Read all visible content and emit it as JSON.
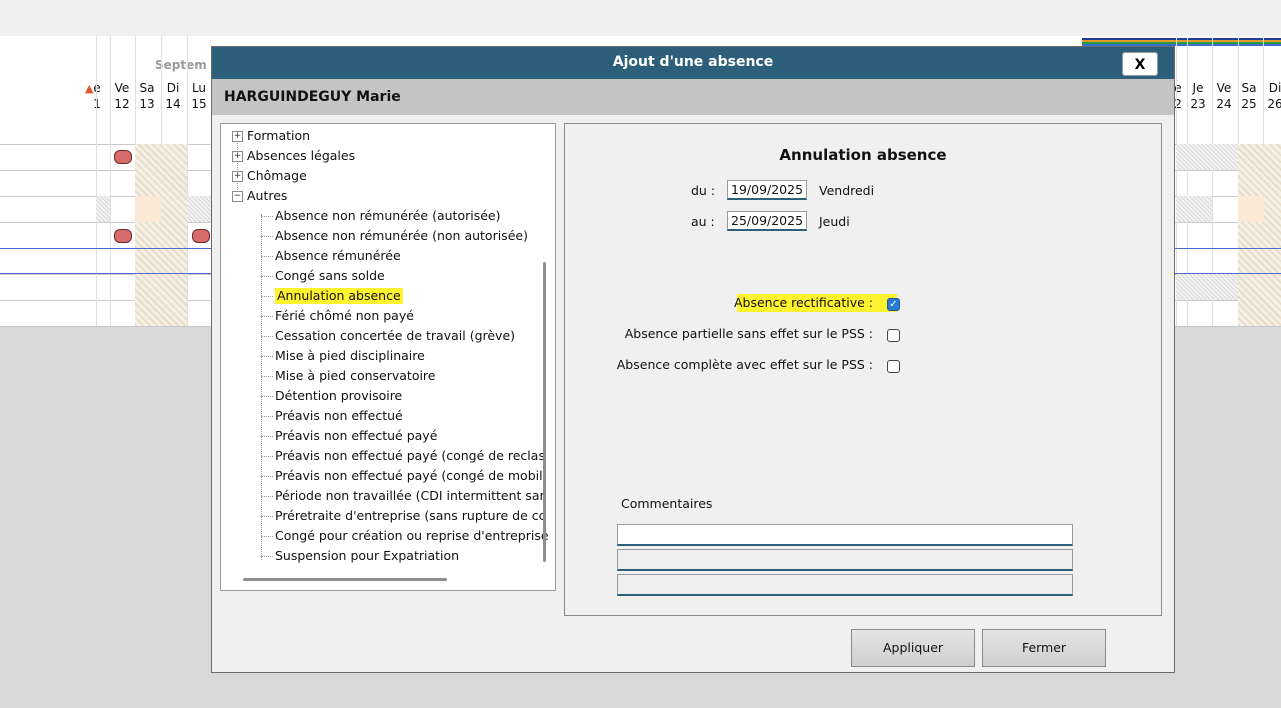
{
  "calendar": {
    "month_partial": "Septem",
    "left_days": [
      {
        "dow": "e",
        "num": "1"
      },
      {
        "dow": "Ve",
        "num": "12"
      },
      {
        "dow": "Sa",
        "num": "13"
      },
      {
        "dow": "Di",
        "num": "14"
      },
      {
        "dow": "Lu",
        "num": "15"
      }
    ],
    "right_days": [
      {
        "dow": "e",
        "num": "2"
      },
      {
        "dow": "Je",
        "num": "23"
      },
      {
        "dow": "Ve",
        "num": "24"
      },
      {
        "dow": "Sa",
        "num": "25"
      },
      {
        "dow": "Di",
        "num": "26"
      }
    ]
  },
  "dialog": {
    "title": "Ajout d'une absence",
    "close_label": "X",
    "employee_name": "HARGUINDEGUY Marie",
    "tree": {
      "groups": [
        "Formation",
        "Absences légales",
        "Chômage",
        "Autres"
      ],
      "items": [
        "Absence non rémunérée (autorisée)",
        "Absence non rémunérée (non autorisée)",
        "Absence rémunérée",
        "Congé sans solde",
        "Annulation absence",
        "Férié chômé non payé",
        "Cessation concertée de travail (grève)",
        "Mise à pied disciplinaire",
        "Mise à pied conservatoire",
        "Détention provisoire",
        "Préavis non effectué",
        "Préavis non effectué payé",
        "Préavis non effectué payé (congé de reclas",
        "Préavis non effectué payé (congé de mobili",
        "Période non travaillée (CDI intermittent sar",
        "Préretraite d'entreprise (sans rupture de cc",
        "Congé pour création ou reprise d'entreprise",
        "Suspension pour Expatriation"
      ],
      "selected_index": 4
    },
    "panel": {
      "title": "Annulation absence",
      "from_label": "du :",
      "from_date": "19/09/2025",
      "from_day": "Vendredi",
      "to_label": "au :",
      "to_date": "25/09/2025",
      "to_day": "Jeudi",
      "checkboxes": [
        {
          "label": "Absence rectificative :",
          "checked": true
        },
        {
          "label": "Absence partielle sans effet sur le PSS :",
          "checked": false
        },
        {
          "label": "Absence complète avec effet sur le PSS :",
          "checked": false
        }
      ],
      "comments_label": "Commentaires"
    },
    "apply_label": "Appliquer",
    "close_button_label": "Fermer",
    "colors": {
      "titlebar": "#2e5f7a",
      "highlight": "#fff22e",
      "checkbox": "#2a7bd3"
    }
  }
}
